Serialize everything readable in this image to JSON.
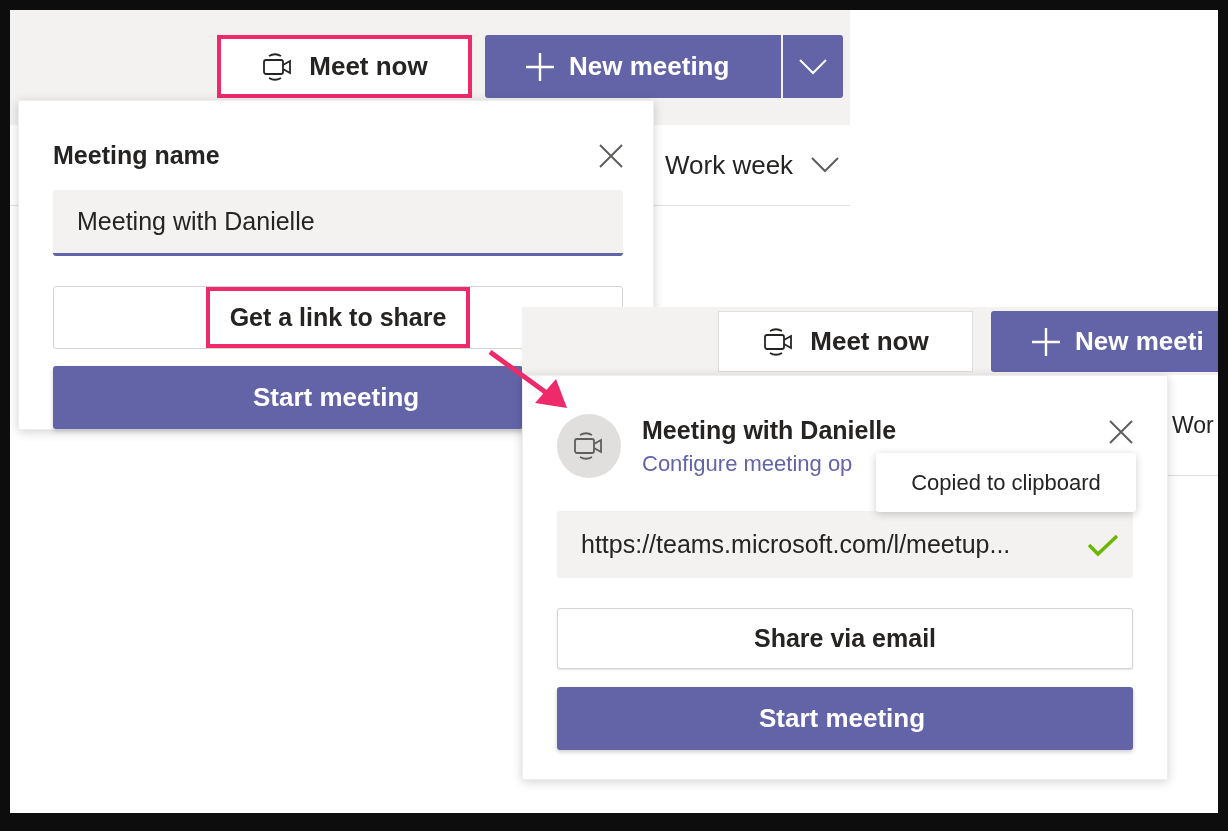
{
  "left_screen": {
    "toolbar": {
      "meet_now": {
        "label": "Meet now",
        "highlighted": true
      },
      "new_meeting": {
        "label": "New meeting"
      }
    },
    "view_selector": "Work week",
    "popover": {
      "title": "Meeting name",
      "name_field": {
        "value": "Meeting with Danielle"
      },
      "link_button": {
        "label": "Get a link to share",
        "highlighted": true
      },
      "start_button": "Start meeting"
    }
  },
  "right_screen": {
    "toolbar": {
      "meet_now": {
        "label": "Meet now",
        "highlighted": false
      },
      "new_meeting": {
        "label": "New meeti"
      }
    },
    "view_selector": "Wor",
    "popover": {
      "title": "Meeting with Danielle",
      "configure_link": "Configure meeting op",
      "tooltip": "Copied to clipboard",
      "link_field": {
        "value": "https://teams.microsoft.com/l/meetup...",
        "copied": true
      },
      "share_button": "Share via email",
      "start_button": "Start meeting"
    }
  }
}
